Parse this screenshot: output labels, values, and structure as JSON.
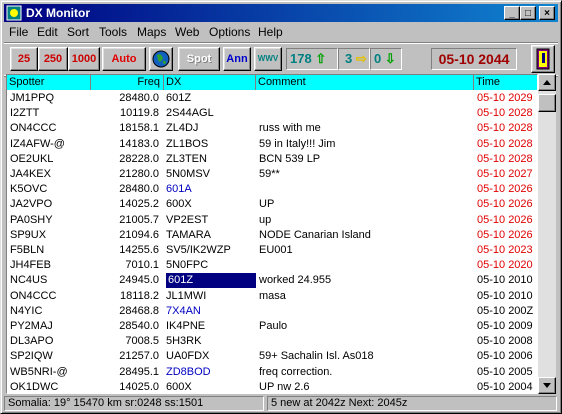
{
  "window": {
    "title": "DX  Monitor"
  },
  "menu": [
    "File",
    "Edit",
    "Sort",
    "Tools",
    "Maps",
    "Web",
    "Options",
    "Help"
  ],
  "toolbar": {
    "b25": "25",
    "b250": "250",
    "b1000": "1000",
    "auto": "Auto",
    "spot": "Spot",
    "ann": "Ann",
    "wwv": "WWV",
    "count1": "178",
    "count2": "3",
    "count3": "0",
    "clock": "05-10 2044"
  },
  "columns": {
    "spotter": "Spotter",
    "freq": "Freq",
    "dx": "DX",
    "comment": "Comment",
    "time": "Time"
  },
  "rows": [
    {
      "spotter": "JM1PPQ",
      "freq": "28480.0",
      "dx": "601Z",
      "comment": "",
      "time": "05-10 2029",
      "dxc": "k",
      "tc": "r"
    },
    {
      "spotter": "I2ZTT",
      "freq": "10119.8",
      "dx": "2S44AGL",
      "comment": "",
      "time": "05-10 2028",
      "dxc": "k",
      "tc": "r"
    },
    {
      "spotter": "ON4CCC",
      "freq": "18158.1",
      "dx": "ZL4DJ",
      "comment": "russ with me",
      "time": "05-10 2028",
      "dxc": "k",
      "tc": "r"
    },
    {
      "spotter": "IZ4AFW-@",
      "freq": "14183.0",
      "dx": "ZL1BOS",
      "comment": "59 in Italy!!! Jim",
      "time": "05-10 2028",
      "dxc": "k",
      "tc": "r"
    },
    {
      "spotter": "OE2UKL",
      "freq": "28228.0",
      "dx": "ZL3TEN",
      "comment": "BCN 539 LP",
      "time": "05-10 2028",
      "dxc": "k",
      "tc": "r"
    },
    {
      "spotter": "JA4KEX",
      "freq": "21280.0",
      "dx": "5N0MSV",
      "comment": "59**",
      "time": "05-10 2027",
      "dxc": "k",
      "tc": "r"
    },
    {
      "spotter": "K5OVC",
      "freq": "28480.0",
      "dx": "601A",
      "comment": "",
      "time": "05-10 2026",
      "dxc": "b",
      "tc": "r"
    },
    {
      "spotter": "JA2VPO",
      "freq": "14025.2",
      "dx": "600X",
      "comment": "UP",
      "time": "05-10 2026",
      "dxc": "k",
      "tc": "r"
    },
    {
      "spotter": "PA0SHY",
      "freq": "21005.7",
      "dx": "VP2EST",
      "comment": "up",
      "time": "05-10 2026",
      "dxc": "k",
      "tc": "r"
    },
    {
      "spotter": "SP9UX",
      "freq": "21094.6",
      "dx": "TAMARA",
      "comment": " NODE Canarian Island",
      "time": "05-10 2026",
      "dxc": "k",
      "tc": "r"
    },
    {
      "spotter": "F5BLN",
      "freq": "14255.6",
      "dx": "SV5/IK2WZP",
      "comment": "EU001",
      "time": "05-10 2023",
      "dxc": "k",
      "tc": "r"
    },
    {
      "spotter": "JH4FEB",
      "freq": "7010.1",
      "dx": "5N0FPC",
      "comment": "",
      "time": "05-10 2020",
      "dxc": "k",
      "tc": "r"
    },
    {
      "spotter": "NC4US",
      "freq": "24945.0",
      "dx": "601Z",
      "comment": "worked 24.955",
      "time": "05-10 2010",
      "dxc": "sel",
      "tc": "k"
    },
    {
      "spotter": "ON4CCC",
      "freq": "18118.2",
      "dx": "JL1MWI",
      "comment": "masa",
      "time": "05-10 2010",
      "dxc": "k",
      "tc": "k"
    },
    {
      "spotter": "N4YIC",
      "freq": "28468.8",
      "dx": "7X4AN",
      "comment": "",
      "time": "05-10 200Z",
      "dxc": "b",
      "tc": "k"
    },
    {
      "spotter": "PY2MAJ",
      "freq": "28540.0",
      "dx": "IK4PNE",
      "comment": "Paulo",
      "time": "05-10 2009",
      "dxc": "k",
      "tc": "k"
    },
    {
      "spotter": "DL3APO",
      "freq": "7008.5",
      "dx": "5H3RK",
      "comment": "",
      "time": "05-10 2008",
      "dxc": "k",
      "tc": "k"
    },
    {
      "spotter": "SP2IQW",
      "freq": "21257.0",
      "dx": "UA0FDX",
      "comment": "59+ Sachalin Isl. As018",
      "time": "05-10 2006",
      "dxc": "k",
      "tc": "k"
    },
    {
      "spotter": "WB5NRI-@",
      "freq": "28495.1",
      "dx": "ZD8BOD",
      "comment": "freq correction.",
      "time": "05-10 2005",
      "dxc": "b",
      "tc": "k"
    },
    {
      "spotter": "OK1DWC",
      "freq": "14025.0",
      "dx": "600X",
      "comment": "UP nw 2.6",
      "time": "05-10 2004",
      "dxc": "k",
      "tc": "k"
    }
  ],
  "status": {
    "left": "Somalia:  19°  15470 km sr:0248 ss:1501",
    "right": "5 new at 2042z Next: 2045z"
  }
}
